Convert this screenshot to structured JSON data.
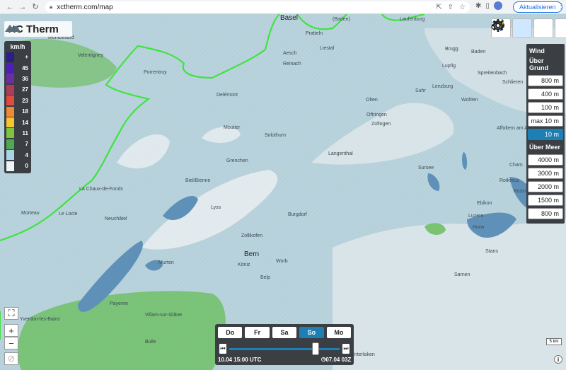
{
  "browser": {
    "url": "xctherm.com/map",
    "update_label": "Aktualisieren"
  },
  "app": {
    "logo_text": "XC Therm"
  },
  "legend": {
    "unit": "km/h",
    "rows": [
      {
        "label": "+",
        "color": "#2a1f8a"
      },
      {
        "label": "45",
        "color": "#4b1fb8"
      },
      {
        "label": "36",
        "color": "#6b2da0"
      },
      {
        "label": "27",
        "color": "#b03a58"
      },
      {
        "label": "23",
        "color": "#e14b3b"
      },
      {
        "label": "18",
        "color": "#f08a32"
      },
      {
        "label": "14",
        "color": "#f4c52e"
      },
      {
        "label": "11",
        "color": "#7dc43c"
      },
      {
        "label": "7",
        "color": "#4fa852"
      },
      {
        "label": "4",
        "color": "#a9d4e6"
      },
      {
        "label": "0",
        "color": "#eef4f8"
      }
    ]
  },
  "tools": [
    {
      "name": "thermal-layer-icon"
    },
    {
      "name": "wind-layer-icon"
    },
    {
      "name": "cloud-layer-icon"
    },
    {
      "name": "settings-gear-icon"
    }
  ],
  "wind_panel": {
    "title": "Wind",
    "above_ground_label": "Über Grund",
    "above_ground": [
      "800 m",
      "400 m",
      "100 m",
      "max 10 m",
      "10 m"
    ],
    "selected": "10 m",
    "above_sea_label": "Über Meer",
    "above_sea": [
      "4000 m",
      "3000 m",
      "2000 m",
      "1500 m",
      "800 m"
    ]
  },
  "map": {
    "towns": [
      {
        "name": "Basel",
        "big": true
      },
      {
        "name": "(Baden)"
      },
      {
        "name": "Laufenburg"
      },
      {
        "name": "Montbéliard"
      },
      {
        "name": "Valentigney"
      },
      {
        "name": "Pratteln"
      },
      {
        "name": "Reinach"
      },
      {
        "name": "Aesch"
      },
      {
        "name": "Liestal"
      },
      {
        "name": "Brugg"
      },
      {
        "name": "Baden"
      },
      {
        "name": "Porrentruy"
      },
      {
        "name": "Lupfig"
      },
      {
        "name": "Spreitenbach"
      },
      {
        "name": "Delémont"
      },
      {
        "name": "Suhr"
      },
      {
        "name": "Lenzburg"
      },
      {
        "name": "Wohlen"
      },
      {
        "name": "Schlieren"
      },
      {
        "name": "Olten"
      },
      {
        "name": "Oftringen"
      },
      {
        "name": "Zofingen"
      },
      {
        "name": "Moutier"
      },
      {
        "name": "Affoltern am Albis"
      },
      {
        "name": "Solothurn"
      },
      {
        "name": "Grenchen"
      },
      {
        "name": "Langenthal"
      },
      {
        "name": "Cham"
      },
      {
        "name": "Sursee"
      },
      {
        "name": "Biel/Bienne"
      },
      {
        "name": "La Chaux-de-Fonds"
      },
      {
        "name": "Rotkreuz"
      },
      {
        "name": "Küssnacht"
      },
      {
        "name": "Morteau"
      },
      {
        "name": "Le Locle"
      },
      {
        "name": "Lyss"
      },
      {
        "name": "Burgdorf"
      },
      {
        "name": "Ebikon"
      },
      {
        "name": "Luzern"
      },
      {
        "name": "Horw"
      },
      {
        "name": "Neuchâtel"
      },
      {
        "name": "Zollikofen"
      },
      {
        "name": "Stans"
      },
      {
        "name": "Bern",
        "big": true
      },
      {
        "name": "Murten"
      },
      {
        "name": "Köniz"
      },
      {
        "name": "Worb"
      },
      {
        "name": "Sarnen"
      },
      {
        "name": "Belp"
      },
      {
        "name": "Payerne"
      },
      {
        "name": "Villars-sur-Glâne"
      },
      {
        "name": "Yverdon-les-Bains"
      },
      {
        "name": "Bulle"
      },
      {
        "name": "Interlaken"
      }
    ],
    "scale": "5 km",
    "info": "i"
  },
  "timeline": {
    "days": [
      "Do",
      "Fr",
      "Sa",
      "So",
      "Mo"
    ],
    "selected_day": "So",
    "start_label": "10.04 15:00 UTC",
    "end_label": "07.04 03Z",
    "progress": 0.78
  }
}
